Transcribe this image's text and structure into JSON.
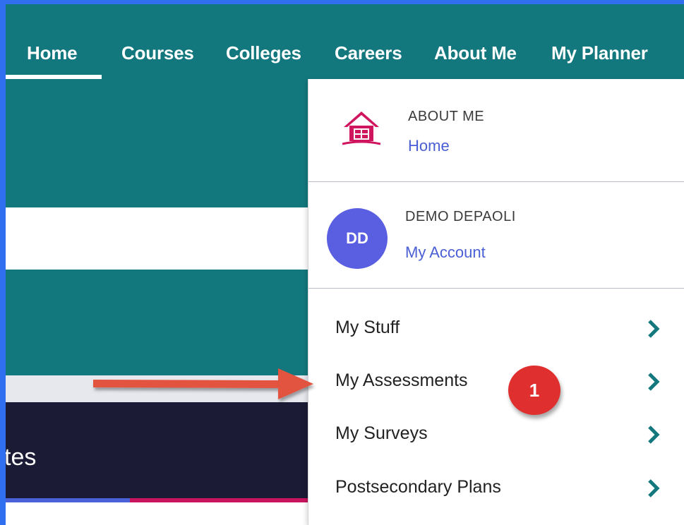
{
  "nav": {
    "items": [
      "Home",
      "Courses",
      "Colleges",
      "Careers",
      "About Me",
      "My Planner"
    ],
    "active": "Home"
  },
  "page": {
    "partial_heading": "tes"
  },
  "dropdown": {
    "section": {
      "title": "ABOUT ME",
      "link": "Home",
      "icon": "house-icon"
    },
    "user": {
      "initials": "DD",
      "name": "DEMO DEPAOLI",
      "link": "My Account"
    },
    "menu": [
      {
        "label": "My Stuff"
      },
      {
        "label": "My Assessments"
      },
      {
        "label": "My Surveys"
      },
      {
        "label": "Postsecondary Plans"
      }
    ]
  },
  "annotation": {
    "badge": "1"
  },
  "colors": {
    "nav_teal": "#13787d",
    "link_blue": "#4a5fd4",
    "avatar_purple": "#5a5ee0",
    "house_pink": "#d0155f",
    "chevron_teal": "#13787d",
    "badge_red": "#e02f2f",
    "arrow_coral": "#e2533f",
    "screenshot_border": "#2f6ff0"
  }
}
